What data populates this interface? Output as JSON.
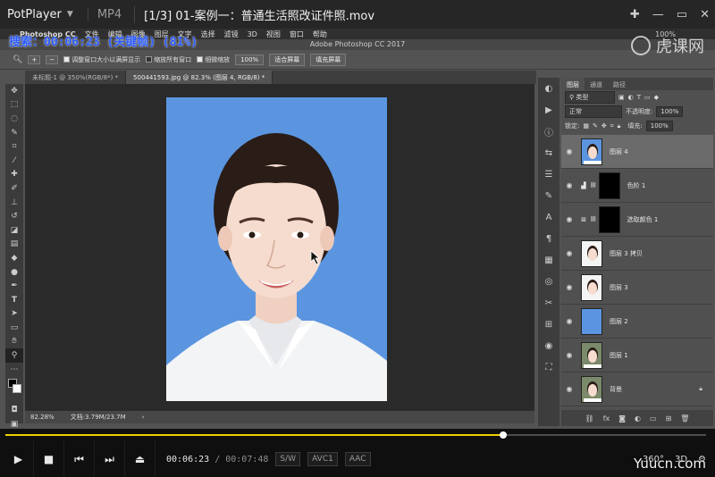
{
  "player": {
    "brand": "PotPlayer",
    "format": "MP4",
    "title": "[1/3] 01-案例一：普通生活照改证件照.mov",
    "current_time": "00:06:23",
    "total_time": "00:07:48",
    "tags": [
      "S/W",
      "AVC1",
      "AAC"
    ],
    "right_controls": [
      "360°",
      "3D"
    ],
    "progress": 0.71,
    "colors": {
      "progress": "#f0d000"
    }
  },
  "overlay": {
    "search_text": "搜索：00:06:23 (关键帧) (81%)",
    "watermark": "虎课网",
    "site_watermark": "Yuucn.com"
  },
  "photoshop": {
    "app_name": "Photoshop CC",
    "menus": [
      "文件",
      "编辑",
      "图像",
      "图层",
      "文字",
      "选择",
      "滤镜",
      "3D",
      "视图",
      "窗口",
      "帮助"
    ],
    "menu_right": [
      "100%"
    ],
    "window_title": "Adobe Photoshop CC 2017",
    "options": {
      "resize_windows": "调整窗口大小以满屏显示",
      "zoom_all": "缩放所有窗口",
      "scrubby_zoom": "细微缩放",
      "zoom_value": "100%",
      "fit_screen": "适合屏幕",
      "fill_screen": "填充屏幕"
    },
    "tabs": [
      "未标题-1 @ 350%(RGB/8*) *",
      "500441593.jpg @ 82.3% (图层 4, RGB/8) *"
    ],
    "status": {
      "zoom": "82.28%",
      "doc": "文档:3.79M/23.7M"
    },
    "layers_panel": {
      "tabs": [
        "图层",
        "通道",
        "路径"
      ],
      "kind": "类型",
      "blend_mode": "正常",
      "opacity_label": "不透明度:",
      "opacity": "100%",
      "lock_label": "锁定:",
      "fill_label": "填充:",
      "fill": "100%",
      "layers": [
        {
          "name": "图层 4",
          "type": "face",
          "selected": true
        },
        {
          "name": "色阶 1",
          "type": "adjust-levels",
          "selected": false
        },
        {
          "name": "选取颜色 1",
          "type": "adjust-selective",
          "selected": false
        },
        {
          "name": "图层 3 拷贝",
          "type": "face-white",
          "selected": false
        },
        {
          "name": "图层 3",
          "type": "face-white",
          "selected": false
        },
        {
          "name": "图层 2",
          "type": "blue",
          "selected": false
        },
        {
          "name": "图层 1",
          "type": "face-outdoor",
          "selected": false
        },
        {
          "name": "背景",
          "type": "face-outdoor",
          "selected": false,
          "locked": true
        }
      ]
    }
  }
}
